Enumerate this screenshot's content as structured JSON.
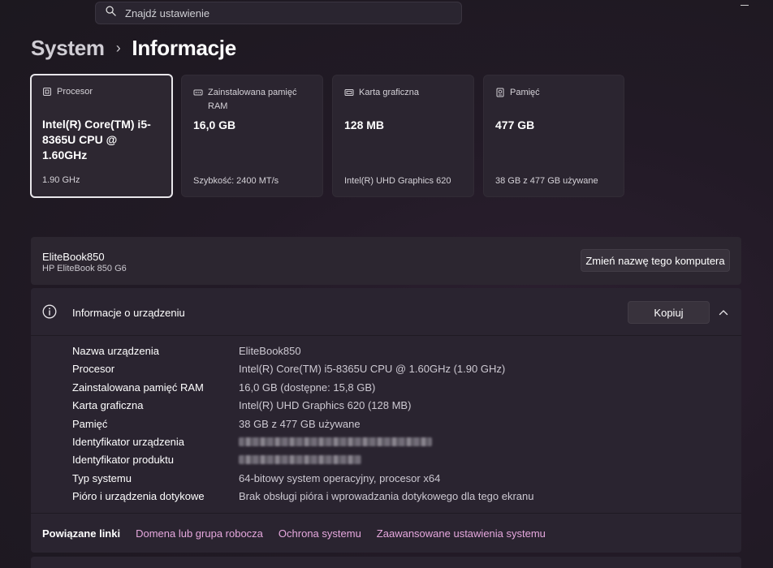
{
  "search": {
    "placeholder": "Znajdź ustawienie"
  },
  "breadcrumb": {
    "parent": "System",
    "separator": "›",
    "current": "Informacje"
  },
  "cards": [
    {
      "label": "Procesor",
      "value": "Intel(R) Core(TM) i5-8365U CPU @ 1.60GHz",
      "sub": "1.90 GHz",
      "icon": "processor-icon",
      "selected": true
    },
    {
      "label": "Zainstalowana pamięć RAM",
      "value": "16,0 GB",
      "sub": "Szybkość: 2400 MT/s",
      "icon": "ram-icon"
    },
    {
      "label": "Karta graficzna",
      "value": "128 MB",
      "sub": "Intel(R) UHD Graphics 620",
      "icon": "gpu-icon"
    },
    {
      "label": "Pamięć",
      "value": "477 GB",
      "sub": "38 GB z 477 GB używane",
      "icon": "storage-icon"
    }
  ],
  "device": {
    "name": "EliteBook850",
    "model": "HP EliteBook 850 G6",
    "rename_label": "Zmień nazwę tego komputera"
  },
  "info": {
    "title": "Informacje o urządzeniu",
    "copy_label": "Kopiuj",
    "rows": [
      {
        "label": "Nazwa urządzenia",
        "value": "EliteBook850"
      },
      {
        "label": "Procesor",
        "value": "Intel(R) Core(TM) i5-8365U CPU @ 1.60GHz (1.90 GHz)"
      },
      {
        "label": "Zainstalowana pamięć RAM",
        "value": "16,0 GB (dostępne: 15,8 GB)"
      },
      {
        "label": "Karta graficzna",
        "value": "Intel(R) UHD Graphics 620 (128 MB)"
      },
      {
        "label": "Pamięć",
        "value": "38 GB z 477 GB używane"
      },
      {
        "label": "Identyfikator urządzenia",
        "value": null
      },
      {
        "label": "Identyfikator produktu",
        "value": null
      },
      {
        "label": "Typ systemu",
        "value": "64-bitowy system operacyjny, procesor x64"
      },
      {
        "label": "Pióro i urządzenia dotykowe",
        "value": "Brak obsługi pióra i wprowadzania dotykowego dla tego ekranu"
      }
    ]
  },
  "related": {
    "label": "Powiązane linki",
    "links": [
      "Domena lub grupa robocza",
      "Ochrona systemu",
      "Zaawansowane ustawienia systemu"
    ]
  },
  "colors": {
    "accent_link": "#e6a8de",
    "background": "#221a26",
    "card": "#2b2530"
  }
}
